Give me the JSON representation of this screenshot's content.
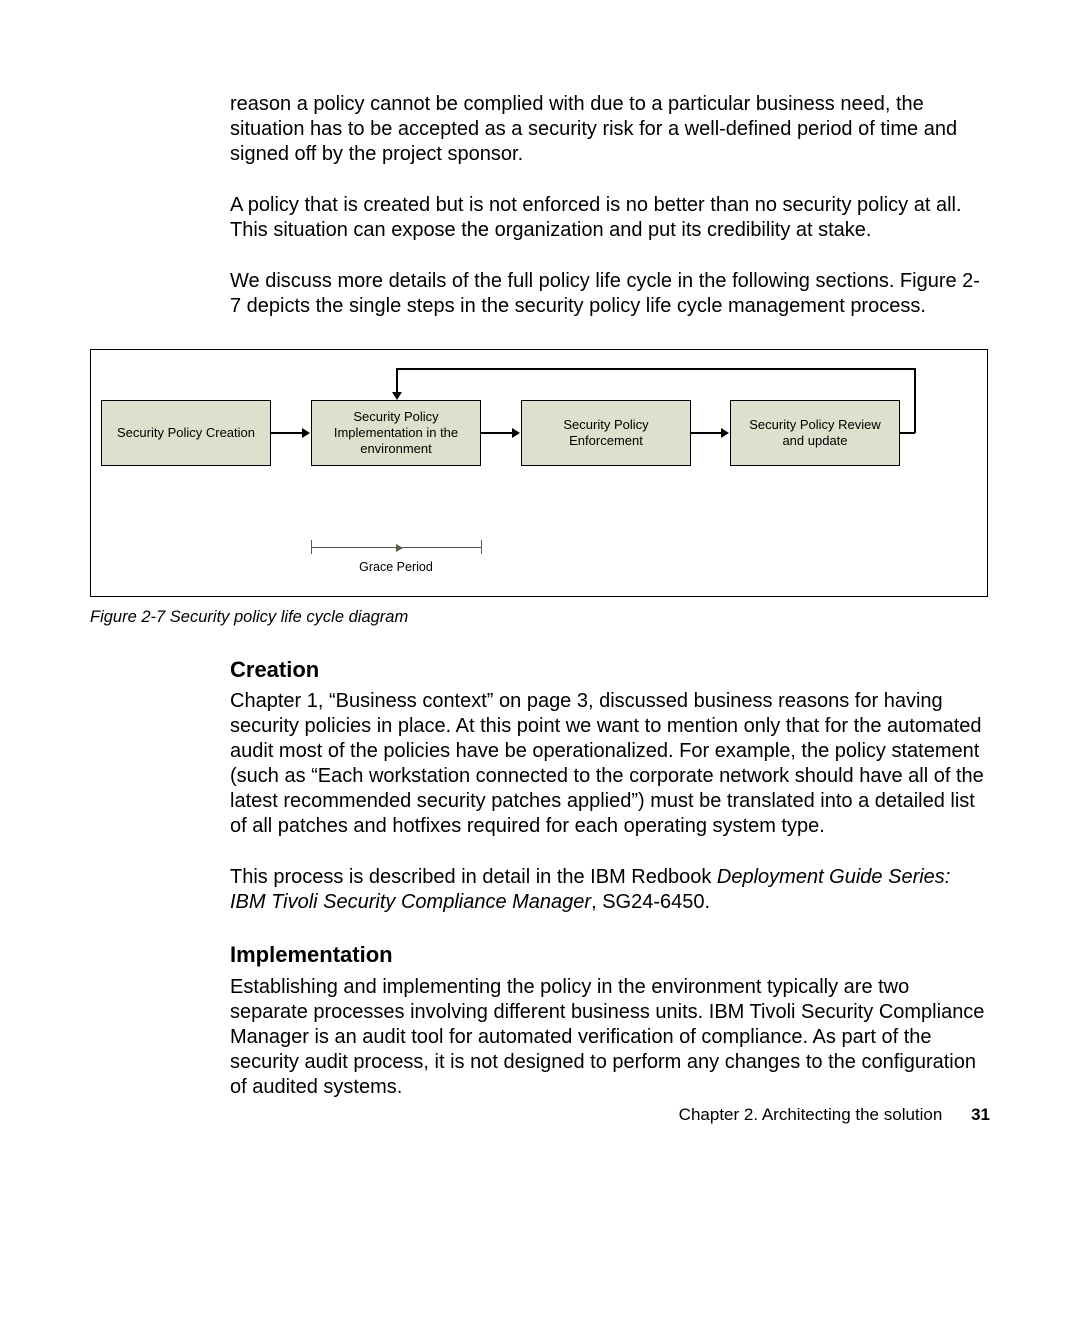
{
  "para1": "reason a policy cannot be complied with due to a particular business need, the situation has to be accepted as a security risk for a well-defined period of time and signed off by the project sponsor.",
  "para2": "A policy that is created but is not enforced is no better than no security policy at all. This situation can expose the organization and put its credibility at stake.",
  "para3": "We discuss more details of the full policy life cycle in the following sections. Figure 2-7 depicts the single steps in the security policy life cycle management process.",
  "figure": {
    "box1": "Security Policy Creation",
    "box2": "Security Policy Implementation in the environment",
    "box3": "Security Policy Enforcement",
    "box4": "Security Policy Review and update",
    "grace": "Grace Period",
    "caption_prefix": "Figure 2-7   ",
    "caption_text": "Security policy life cycle diagram"
  },
  "sec1": {
    "heading": "Creation",
    "p1": "Chapter 1, “Business context” on page 3, discussed business reasons for having security policies in place. At this point we want to mention only that for the automated audit most of the policies have be operationalized. For example, the policy statement (such as “Each workstation connected to the corporate network should have all of the latest recommended security patches applied”) must be translated into a detailed list of all patches and hotfixes required for each operating system type.",
    "p2a": "This process is described in detail in the IBM Redbook ",
    "p2_ital": "Deployment Guide Series: IBM Tivoli Security Compliance Manager",
    "p2b": ", SG24-6450."
  },
  "sec2": {
    "heading": "Implementation",
    "p1": "Establishing and implementing the policy in the environment typically are two separate processes involving different business units. IBM Tivoli Security Compliance Manager is an audit tool for automated verification of compliance. As part of the security audit process, it is not designed to perform any changes to the configuration of audited systems."
  },
  "footer": {
    "chapter": "Chapter 2. Architecting the solution",
    "page": "31"
  }
}
